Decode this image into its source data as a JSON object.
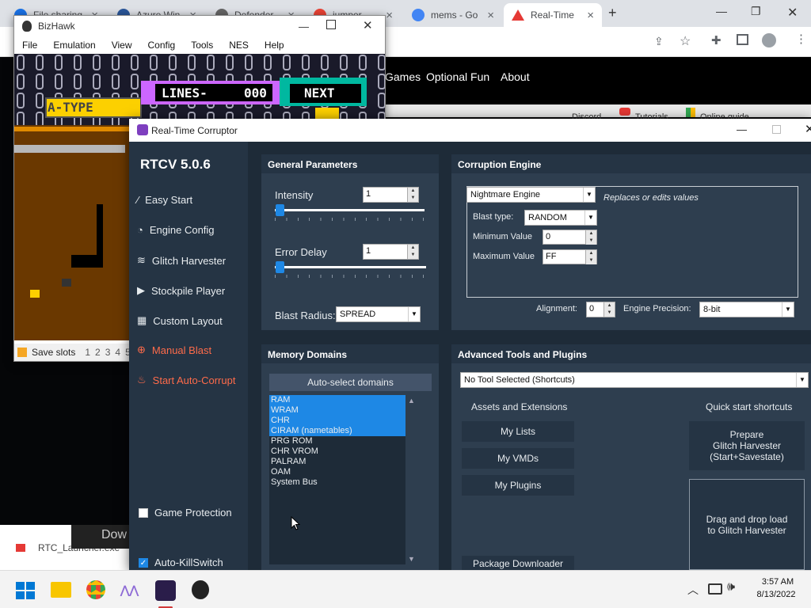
{
  "browser": {
    "tabs": [
      {
        "title": "File sharing",
        "icon": "edge-icon",
        "color": "#1a73e8"
      },
      {
        "title": "Azure Win",
        "icon": "azure-icon",
        "color": "#2b579a"
      },
      {
        "title": "Defender",
        "icon": "defender-icon",
        "color": "#444444"
      },
      {
        "title": "jumper",
        "icon": "google-icon",
        "color": "#ea4335"
      },
      {
        "title": "mems - Go",
        "icon": "google-icon",
        "color": "#4285f4"
      },
      {
        "title": "Real-Time",
        "icon": "rtc-icon",
        "color": "#e53935"
      }
    ],
    "new_tab": "+",
    "site_nav": [
      "Games",
      "Optional Fun",
      "About"
    ],
    "bookmarks": [
      "Discord",
      "Tutorials",
      "Online guide"
    ],
    "download": "Dow",
    "download_file": "RTC_Launcher.exe"
  },
  "bizhawk": {
    "title": "BizHawk",
    "menu": [
      "File",
      "Emulation",
      "View",
      "Config",
      "Tools",
      "NES",
      "Help"
    ],
    "game_text": {
      "atype": "A-TYPE",
      "lines": "LINES-",
      "lines_value": "000",
      "next": "NEXT"
    },
    "status_label": "Save slots",
    "slots": [
      "1",
      "2",
      "3",
      "4",
      "5"
    ]
  },
  "rtc": {
    "title": "Real-Time Corruptor",
    "version": "RTCV 5.0.6",
    "sidebar": [
      {
        "label": "Easy Start",
        "icon": "wand-icon"
      },
      {
        "label": "Engine Config",
        "icon": "gauge-icon"
      },
      {
        "label": "Glitch Harvester",
        "icon": "layers-icon"
      },
      {
        "label": "Stockpile Player",
        "icon": "play-icon"
      },
      {
        "label": "Custom Layout",
        "icon": "grid-icon"
      },
      {
        "label": "Manual Blast",
        "icon": "target-icon"
      },
      {
        "label": "Start Auto-Corrupt",
        "icon": "fire-icon"
      }
    ],
    "game_protection": "Game Protection",
    "auto_killswitch": "Auto-KillSwitch",
    "general": {
      "title": "General Parameters",
      "intensity_label": "Intensity",
      "intensity_value": "1",
      "error_delay_label": "Error Delay",
      "error_delay_value": "1",
      "blast_radius_label": "Blast Radius:",
      "blast_radius_value": "SPREAD"
    },
    "engine": {
      "title": "Corruption Engine",
      "engine_value": "Nightmare Engine",
      "engine_desc": "Replaces or edits values",
      "blast_type_label": "Blast type:",
      "blast_type_value": "RANDOM",
      "min_label": "Minimum Value",
      "min_value": "0",
      "max_label": "Maximum Value",
      "max_value": "FF",
      "alignment_label": "Alignment:",
      "alignment_value": "0",
      "precision_label": "Engine Precision:",
      "precision_value": "8-bit"
    },
    "memory": {
      "title": "Memory Domains",
      "auto_select": "Auto-select domains",
      "domains": [
        {
          "name": "RAM",
          "selected": true
        },
        {
          "name": "WRAM",
          "selected": true
        },
        {
          "name": "CHR",
          "selected": true
        },
        {
          "name": "CIRAM (nametables)",
          "selected": true
        },
        {
          "name": "PRG ROM",
          "selected": false
        },
        {
          "name": "CHR VROM",
          "selected": false
        },
        {
          "name": "PALRAM",
          "selected": false
        },
        {
          "name": "OAM",
          "selected": false
        },
        {
          "name": "System Bus",
          "selected": false
        }
      ]
    },
    "tools": {
      "title": "Advanced Tools and Plugins",
      "tool_select": "No Tool Selected (Shortcuts)",
      "assets_header": "Assets and Extensions",
      "quick_header": "Quick start shortcuts",
      "my_lists": "My Lists",
      "my_vmds": "My VMDs",
      "my_plugins": "My Plugins",
      "package_downloader": "Package Downloader",
      "prepare_gh": "Prepare\nGlitch Harvester\n(Start+Savestate)",
      "drag_drop": "Drag and drop load\nto Glitch Harvester"
    }
  },
  "taskbar": {
    "time": "3:57 AM",
    "date": "8/13/2022",
    "apps": [
      "start-icon",
      "explorer-icon",
      "chrome-icon",
      "rtc-launcher-icon",
      "rtc-active-icon",
      "bizhawk-icon"
    ]
  }
}
